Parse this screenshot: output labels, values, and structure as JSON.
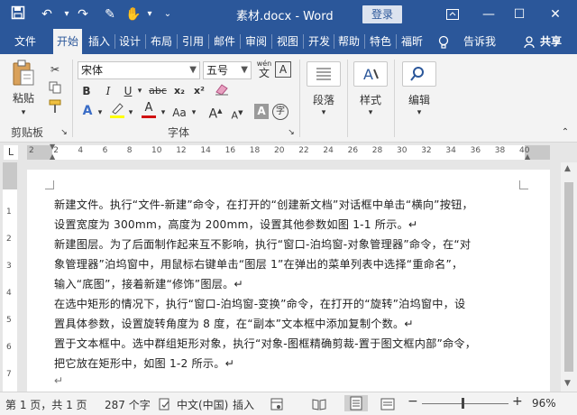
{
  "titlebar": {
    "title": "素材.docx",
    "app": "Word",
    "login": "登录"
  },
  "tabs": [
    "文件",
    "开始",
    "插入",
    "设计",
    "布局",
    "引用",
    "邮件",
    "审阅",
    "视图",
    "开发",
    "帮助",
    "特色",
    "福昕",
    "告诉我",
    "共享"
  ],
  "ribbon": {
    "clipboard": {
      "paste": "粘贴",
      "label": "剪贴板"
    },
    "font": {
      "name": "宋体",
      "size": "五号",
      "wen": "wén",
      "A_box": "A",
      "bold": "B",
      "italic": "I",
      "underline": "U",
      "strike": "abc",
      "sub": "x₂",
      "sup": "x²",
      "aa": "Aa",
      "grow": "A",
      "shrink": "A",
      "char": "字",
      "label": "字体"
    },
    "paragraph": {
      "label": "段落"
    },
    "styles": {
      "label": "样式"
    },
    "editing": {
      "label": "编辑"
    }
  },
  "ruler": {
    "numbers": [
      "2",
      "2",
      "4",
      "6",
      "8",
      "10",
      "12",
      "14",
      "16",
      "18",
      "20",
      "22",
      "24",
      "26",
      "28",
      "30",
      "32",
      "34",
      "36",
      "38",
      "40"
    ]
  },
  "vruler": [
    "1",
    "2",
    "3",
    "4",
    "5",
    "6",
    "7"
  ],
  "document": {
    "lines": [
      "新建文件。执行“文件-新建”命令，在打开的“创建新文档”对话框中单击“横向”按钮，",
      "设置宽度为 300mm，高度为 200mm，设置其他参数如图 1-1 所示。↵",
      "新建图层。为了后面制作起来互不影响，执行“窗口-泊坞窗-对象管理器”命令，在“对",
      "象管理器”泊坞窗中，用鼠标右键单击“图层 1”在弹出的菜单列表中选择“重命名”，",
      "输入“底图”，接着新建“修饰”图层。↵",
      "在选中矩形的情况下，执行“窗口-泊坞窗-变换”命令，在打开的“旋转”泊坞窗中，设",
      "置具体参数，设置旋转角度为 8 度，在“副本”文本框中添加复制个数。↵",
      "置于文本框中。选中群组矩形对象，执行“对象-图框精确剪裁-置于图文框内部”命令，",
      "把它放在矩形中，如图 1-2 所示。↵",
      "↵"
    ]
  },
  "status": {
    "page": "第 1 页，共 1 页",
    "words": "287 个字",
    "lang": "中文(中国)",
    "mode": "插入",
    "zoom_minus": "−",
    "zoom_plus": "+",
    "zoom": "96%"
  }
}
